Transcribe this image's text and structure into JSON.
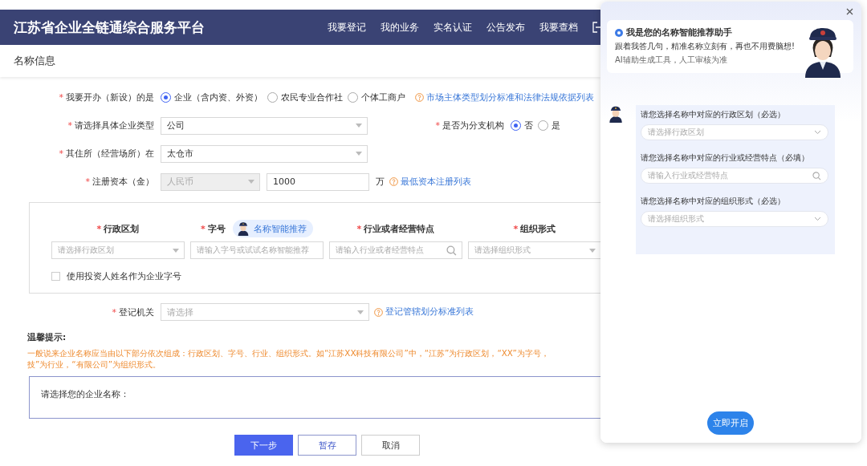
{
  "header": {
    "title": "江苏省企业全链通综合服务平台",
    "nav": [
      "我要登记",
      "我的业务",
      "实名认证",
      "公告发布",
      "我要查档"
    ]
  },
  "section_title": "名称信息",
  "form": {
    "entity_type": {
      "star": "*",
      "label": "我要开办（新设）的是",
      "options": [
        {
          "label": "企业（含内资、外资）",
          "selected": true
        },
        {
          "label": "农民专业合作社",
          "selected": false
        },
        {
          "label": "个体工商户",
          "selected": false
        }
      ],
      "help_link": "市场主体类型划分标准和法律法规依据列表"
    },
    "enterprise_type": {
      "star": "*",
      "label": "请选择具体企业类型",
      "value": "公司"
    },
    "branch": {
      "star": "*",
      "label": "是否为分支机构",
      "options": [
        {
          "label": "否",
          "selected": true
        },
        {
          "label": "是",
          "selected": false
        }
      ]
    },
    "residence": {
      "star": "*",
      "label": "其住所（经营场所）在",
      "value": "太仓市"
    },
    "capital": {
      "star": "*",
      "label": "注册资本（金）",
      "currency": "人民币",
      "amount": "1000",
      "unit": "万",
      "help_link": "最低资本注册列表"
    },
    "name_parts": {
      "fields": [
        {
          "star": "*",
          "label": "行政区划",
          "kind": "select",
          "placeholder": "请选择行政区划"
        },
        {
          "star": "*",
          "label": "字号",
          "kind": "input",
          "placeholder": "请输入字号或试试名称智能推荐",
          "badge": "名称智能推荐"
        },
        {
          "star": "*",
          "label": "行业或者经营特点",
          "kind": "search",
          "placeholder": "请输入行业或者经营特点"
        },
        {
          "star": "*",
          "label": "组织形式",
          "kind": "select",
          "placeholder": "请选择组织形式"
        }
      ],
      "use_investor_name": {
        "label": "使用投资人姓名作为企业字号",
        "checked": false
      }
    },
    "registry": {
      "star": "*",
      "label": "登记机关",
      "placeholder": "请选择",
      "help_link": "登记管辖划分标准列表"
    }
  },
  "tips": {
    "title": "温馨提示:",
    "lines": [
      "一般说来企业名称应当由以下部分依次组成：行政区划、字号、行业、组织形式。如“江苏XX科技有限公司”中，“江苏”为行政区划，“XX”为字号，",
      "技”为行业，“有限公司”为组织形式。"
    ]
  },
  "name_box": {
    "label": "请选择您的企业名称："
  },
  "buttons": [
    {
      "label": "下一步",
      "kind": "primary"
    },
    {
      "label": "暂存",
      "kind": "outline"
    },
    {
      "label": "取消",
      "kind": "plain"
    }
  ],
  "assistant": {
    "title": "我是您的名称智能推荐助手",
    "subtitle": "跟着我答几句，精准名称立刻有，再也不用费脑想!",
    "note": "AI辅助生成工具，人工审核为准",
    "questions": [
      {
        "label": "请您选择名称中对应的行政区划（必选）",
        "kind": "select",
        "placeholder": "请选择行政区划"
      },
      {
        "label": "请您选择名称中对应的行业或经营特点（必填）",
        "kind": "search",
        "placeholder": "请输入行业或经营特点"
      },
      {
        "label": "请您选择名称中对应的组织形式（必选）",
        "kind": "select",
        "placeholder": "请选择组织形式"
      }
    ],
    "start_button": "立即开启"
  }
}
